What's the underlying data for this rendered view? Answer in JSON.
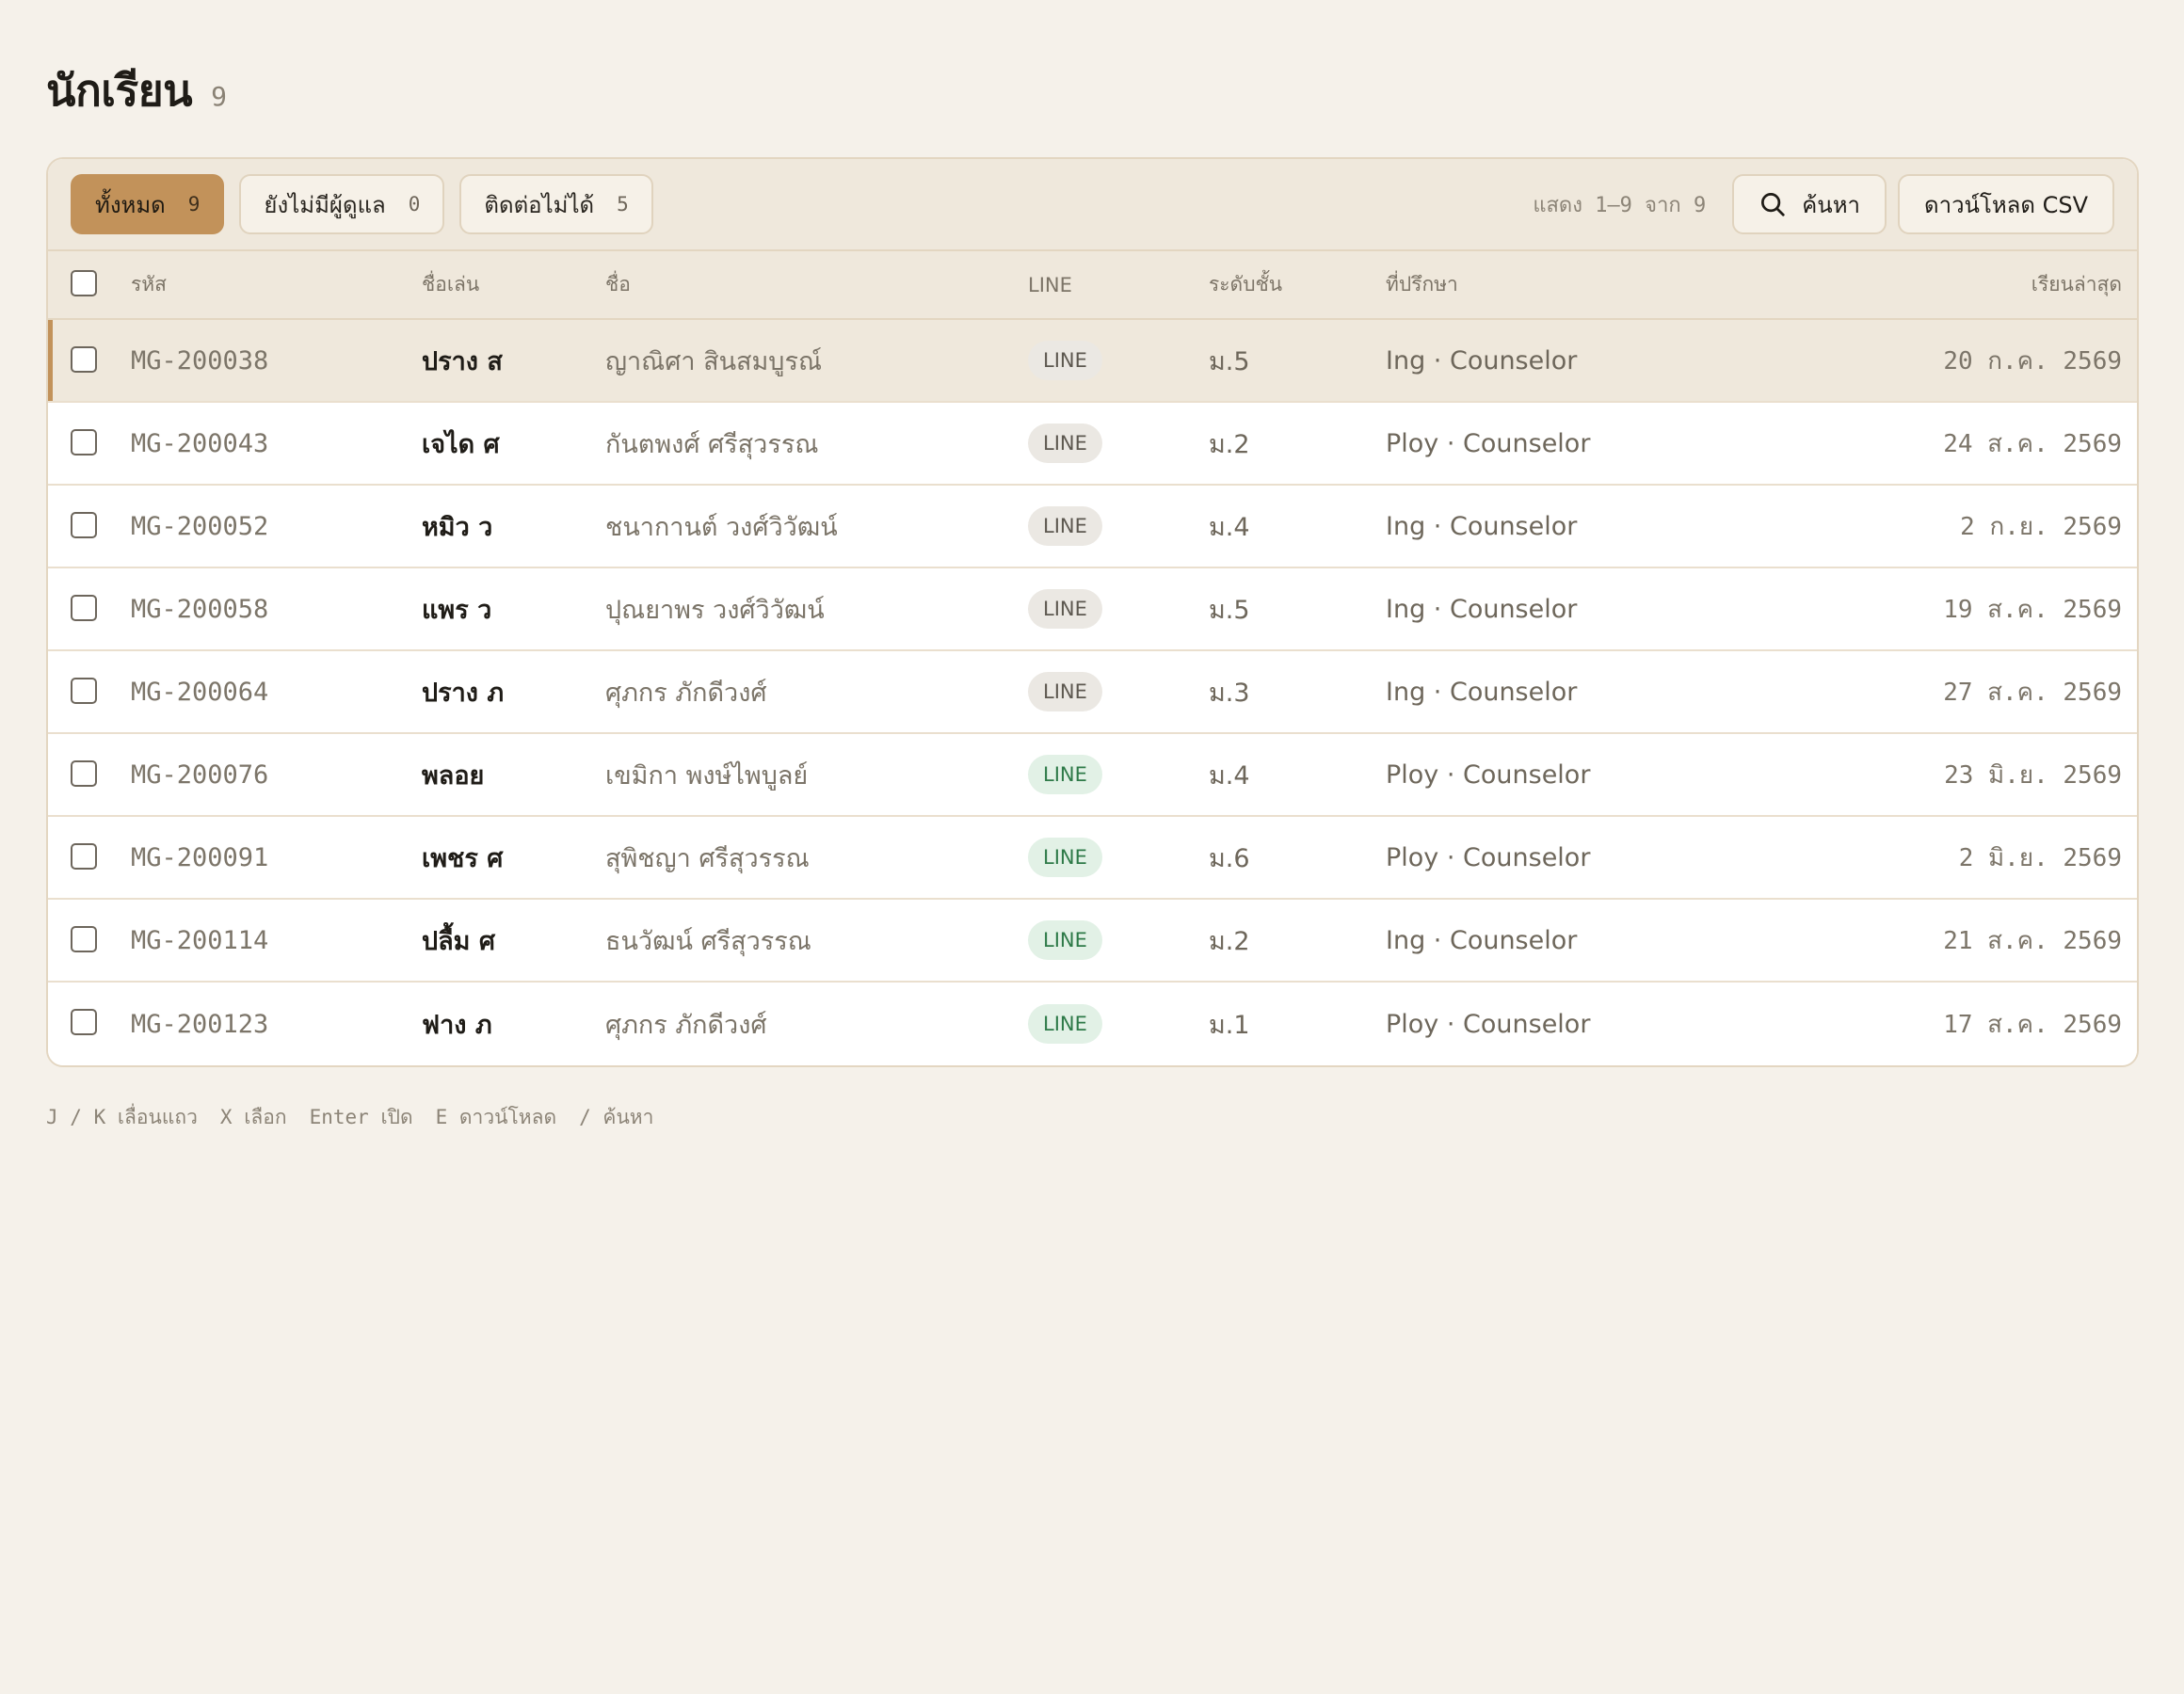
{
  "header": {
    "title": "นักเรียน",
    "count": "9"
  },
  "filters": [
    {
      "label": "ทั้งหมด",
      "count": "9",
      "active": true
    },
    {
      "label": "ยังไม่มีผู้ดูแล",
      "count": "0",
      "active": false
    },
    {
      "label": "ติดต่อไม่ได้",
      "count": "5",
      "active": false
    }
  ],
  "toolbar": {
    "range_text": "แสดง 1–9 จาก 9",
    "search_label": "ค้นหา",
    "download_label": "ดาวน์โหลด CSV"
  },
  "table": {
    "columns": {
      "code": "รหัส",
      "nick": "ชื่อเล่น",
      "name": "ชื่อ",
      "line": "LINE",
      "grade": "ระดับชั้น",
      "advisor": "ที่ปรึกษา",
      "last": "เรียนล่าสุด"
    },
    "rows": [
      {
        "code": "MG-200038",
        "nick": "ปราง ส",
        "name": "ญาณิศา สินสมบูรณ์",
        "line": "LINE",
        "line_connected": false,
        "grade": "ม.5",
        "advisor": "Ing · Counselor",
        "last": "20 ก.ค. 2569",
        "selected": true
      },
      {
        "code": "MG-200043",
        "nick": "เจได ศ",
        "name": "กันตพงศ์ ศรีสุวรรณ",
        "line": "LINE",
        "line_connected": false,
        "grade": "ม.2",
        "advisor": "Ploy · Counselor",
        "last": "24 ส.ค. 2569",
        "selected": false
      },
      {
        "code": "MG-200052",
        "nick": "หมิว ว",
        "name": "ชนากานต์ วงศ์วิวัฒน์",
        "line": "LINE",
        "line_connected": false,
        "grade": "ม.4",
        "advisor": "Ing · Counselor",
        "last": "2 ก.ย. 2569",
        "selected": false
      },
      {
        "code": "MG-200058",
        "nick": "แพร ว",
        "name": "ปุณยาพร วงศ์วิวัฒน์",
        "line": "LINE",
        "line_connected": false,
        "grade": "ม.5",
        "advisor": "Ing · Counselor",
        "last": "19 ส.ค. 2569",
        "selected": false
      },
      {
        "code": "MG-200064",
        "nick": "ปราง ภ",
        "name": "ศุภกร ภักดีวงศ์",
        "line": "LINE",
        "line_connected": false,
        "grade": "ม.3",
        "advisor": "Ing · Counselor",
        "last": "27 ส.ค. 2569",
        "selected": false
      },
      {
        "code": "MG-200076",
        "nick": "พลอย",
        "name": "เขมิกา พงษ์ไพบูลย์",
        "line": "LINE",
        "line_connected": true,
        "grade": "ม.4",
        "advisor": "Ploy · Counselor",
        "last": "23 มิ.ย. 2569",
        "selected": false
      },
      {
        "code": "MG-200091",
        "nick": "เพชร ศ",
        "name": "สุพิชญา ศรีสุวรรณ",
        "line": "LINE",
        "line_connected": true,
        "grade": "ม.6",
        "advisor": "Ploy · Counselor",
        "last": "2 มิ.ย. 2569",
        "selected": false
      },
      {
        "code": "MG-200114",
        "nick": "ปลื้ม ศ",
        "name": "ธนวัฒน์ ศรีสุวรรณ",
        "line": "LINE",
        "line_connected": true,
        "grade": "ม.2",
        "advisor": "Ing · Counselor",
        "last": "21 ส.ค. 2569",
        "selected": false
      },
      {
        "code": "MG-200123",
        "nick": "ฟาง ภ",
        "name": "ศุภกร ภักดีวงศ์",
        "line": "LINE",
        "line_connected": true,
        "grade": "ม.1",
        "advisor": "Ploy · Counselor",
        "last": "17 ส.ค. 2569",
        "selected": false
      }
    ]
  },
  "shortcuts": [
    "J / K เลื่อนแถว",
    "X เลือก",
    "Enter เปิด",
    "E ดาวน์โหลด",
    "/ ค้นหา"
  ],
  "colors": {
    "accent": "#c2925a",
    "background": "#f5f1ea",
    "line_connected_bg": "#e2f1e6",
    "line_connected_text": "#2e7a48",
    "line_disconnected_bg": "#ebe8e3"
  },
  "icons": {
    "search": "search-icon"
  }
}
